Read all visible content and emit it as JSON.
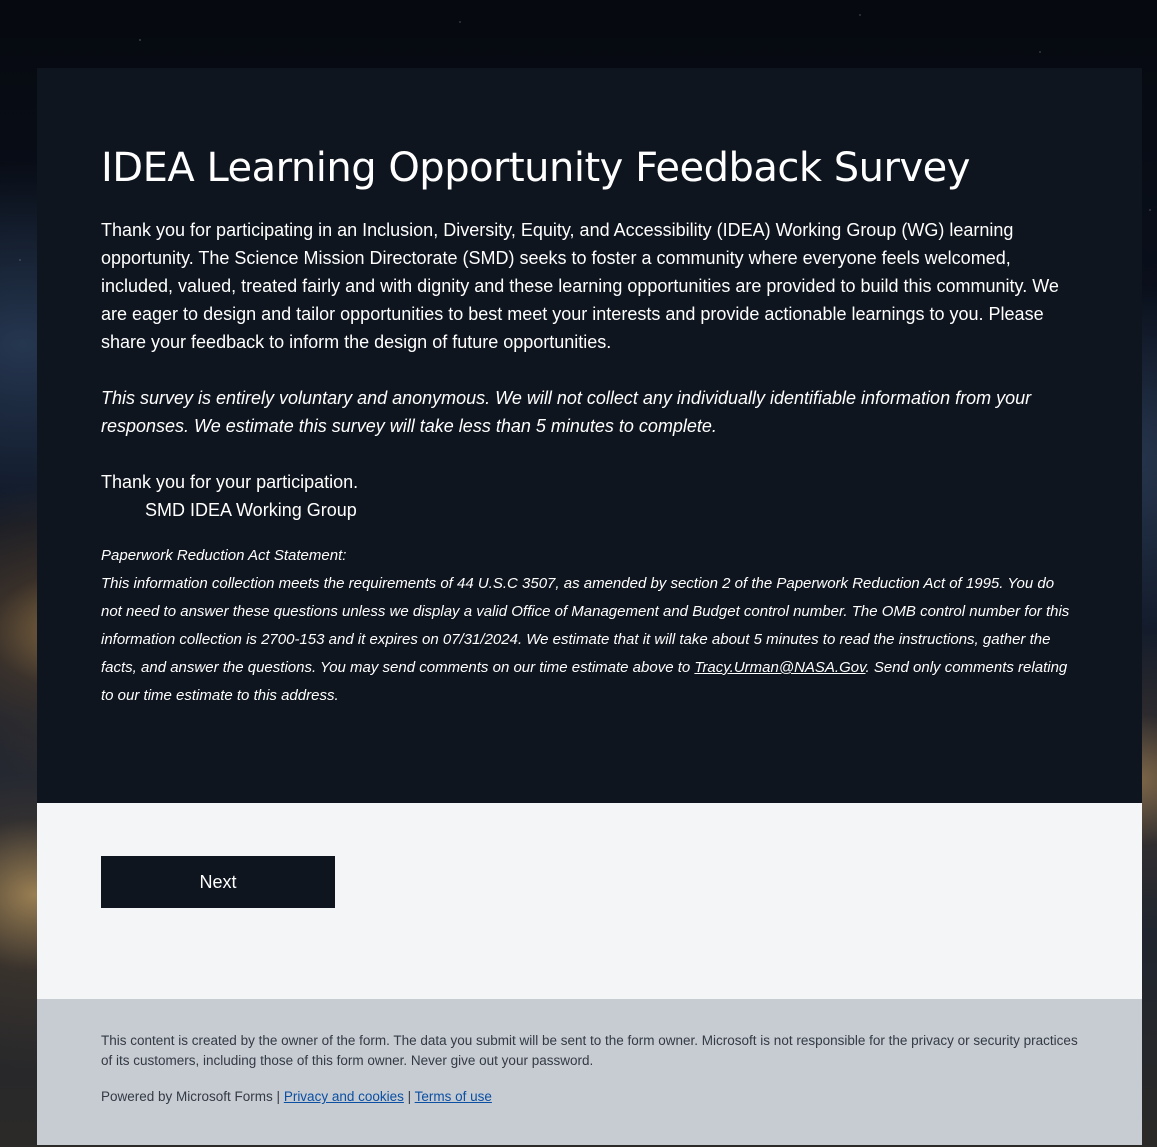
{
  "survey": {
    "title": "IDEA Learning Opportunity Feedback Survey",
    "intro": "Thank you for participating in an Inclusion, Diversity, Equity, and Accessibility (IDEA) Working Group (WG) learning opportunity.  The Science Mission Directorate (SMD) seeks to foster a community where everyone feels welcomed, included, valued, treated fairly and with dignity and these learning opportunities are provided to build this community.  We are eager to design and tailor opportunities to best meet your interests and provide actionable learnings to you.  Please share your feedback to inform the design of future opportunities.",
    "voluntary_note": "This survey is entirely voluntary and anonymous.  We will not collect any individually identifiable information from your responses.  We estimate this survey will take less than 5 minutes to complete.",
    "thanks": "Thank you for your participation.",
    "signature": "SMD IDEA Working Group",
    "pra_heading": "Paperwork Reduction Act Statement:",
    "pra_text_before": "This information collection meets the requirements of 44 U.S.C 3507, as amended by section 2 of the Paperwork Reduction Act of 1995. You do not need to answer these questions unless we display a valid Office of Management and Budget control number. The OMB control number for this information collection is 2700-153 and it expires on 07/31/2024. We estimate that it will take about 5 minutes to read the instructions, gather the facts, and answer the questions. You may send comments on our time estimate above to ",
    "pra_email": "Tracy.Urman@NASA.Gov",
    "pra_text_after": ". Send only comments relating to our time estimate to this address."
  },
  "actions": {
    "next_label": "Next"
  },
  "footer": {
    "disclaimer": "This content is created by the owner of the form. The data you submit will be sent to the form owner. Microsoft is not responsible for the privacy or security practices of its customers, including those of this form owner. Never give out your password.",
    "powered_by": "Powered by Microsoft Forms | ",
    "privacy_link": "Privacy and cookies",
    "separator": " | ",
    "terms_link": "Terms of use"
  }
}
